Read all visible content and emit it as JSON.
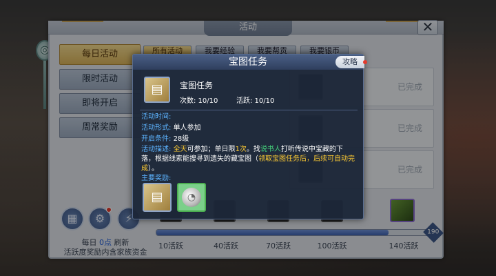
{
  "window": {
    "title": "活动",
    "close_symbol": "✕"
  },
  "sidebar": {
    "items": [
      {
        "label": "每日活动",
        "active": true
      },
      {
        "label": "限时活动",
        "active": false
      },
      {
        "label": "即将开启",
        "active": false
      },
      {
        "label": "周常奖励",
        "active": false
      }
    ]
  },
  "tabs": [
    {
      "label": "所有活动",
      "active": true
    },
    {
      "label": "我要经验",
      "active": false
    },
    {
      "label": "我要帮贡",
      "active": false
    },
    {
      "label": "我要银币",
      "active": false
    }
  ],
  "list_cards": [
    {
      "status": "已完成"
    },
    {
      "status": "已完成"
    },
    {
      "status": "已完成"
    }
  ],
  "bottom": {
    "refresh_prefix": "每日",
    "refresh_time": "0点",
    "refresh_suffix": "刷新",
    "fund_text": "活跃度奖励内含家族资金",
    "icons": [
      "calendar-icon",
      "gear-icon",
      "lightning-icon"
    ],
    "progress_max": "190",
    "progress_value": 160,
    "milestones": [
      "10活跃",
      "40活跃",
      "70活跃",
      "100活跃",
      "140活跃"
    ]
  },
  "popup": {
    "title": "宝图任务",
    "strategy_label": "攻略",
    "task_name": "宝图任务",
    "times_label": "次数: 10/10",
    "activity_label": "活跃: 10/10",
    "time_key": "活动时间:",
    "form_key": "活动形式:",
    "form_value": "单人参加",
    "condition_key": "开启条件:",
    "condition_value": "28级",
    "desc_key": "活动描述:",
    "desc": {
      "p1": "全天",
      "p2": "可参加；单日限",
      "p3": "1次",
      "p4": "。找",
      "p5": "说书人",
      "p6": "打听传说中宝藏的下落，根据线索能搜寻到遗失的藏宝图（",
      "p7": "领取宝图任务后，后续可自动完成",
      "p8": "）。"
    },
    "reward_key": "主要奖励:",
    "colors": {
      "key": "#5cb3ff",
      "highlight_yellow": "#ffcc33",
      "highlight_green": "#44d07a"
    }
  }
}
